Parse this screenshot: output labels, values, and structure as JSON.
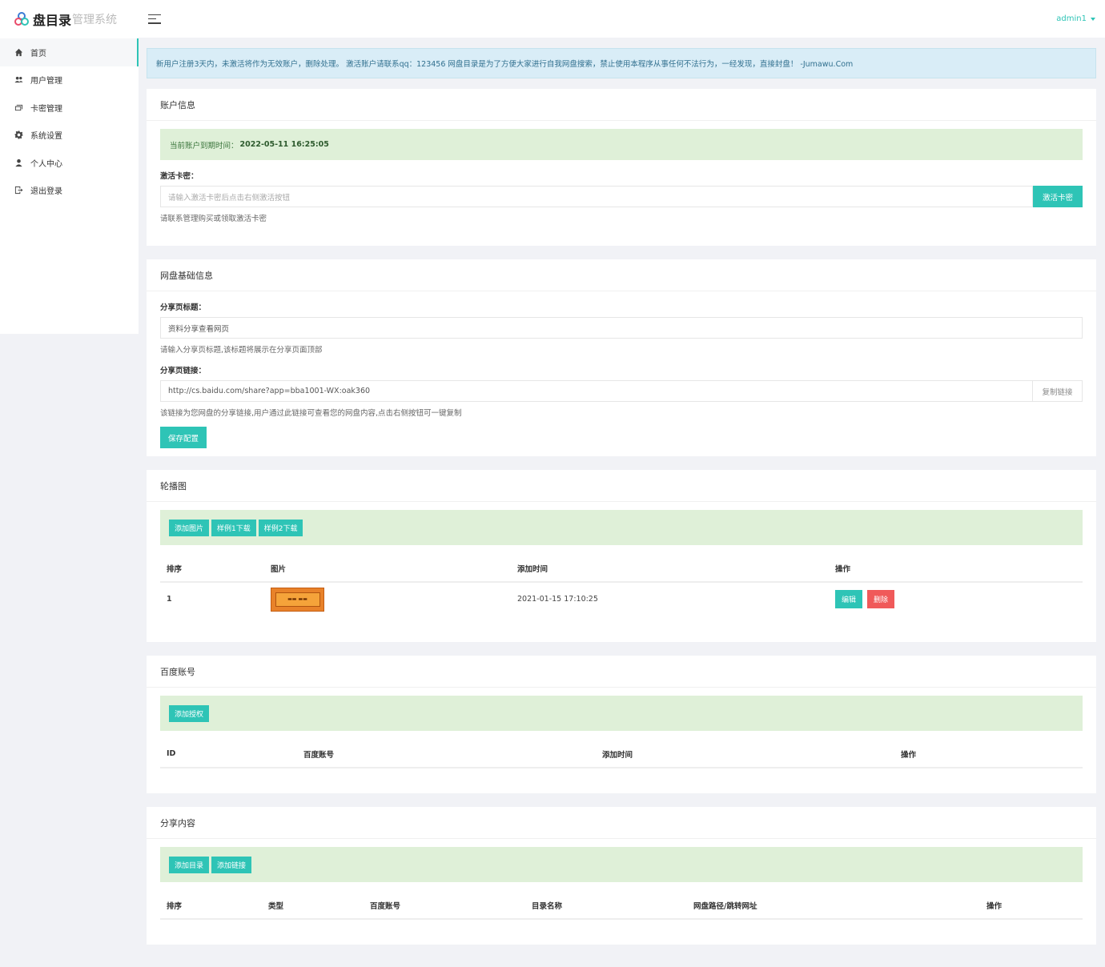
{
  "app": {
    "brand": "盘目录",
    "brand_sub": "管理系统"
  },
  "sidebar": {
    "items": [
      {
        "label": "首页",
        "icon": "home-icon"
      },
      {
        "label": "用户管理",
        "icon": "users-icon"
      },
      {
        "label": "卡密管理",
        "icon": "cards-icon"
      },
      {
        "label": "系统设置",
        "icon": "gear-icon"
      },
      {
        "label": "个人中心",
        "icon": "person-icon"
      },
      {
        "label": "退出登录",
        "icon": "logout-icon"
      }
    ]
  },
  "header": {
    "user": "admin1"
  },
  "notice": "新用户注册3天内，未激活将作为无效账户，删除处理。 激活账户请联系qq：123456 网盘目录是为了方便大家进行自我网盘搜索，禁止使用本程序从事任何不法行为，一经发现，直接封盘！ -Jumawu.Com",
  "account": {
    "title": "账户信息",
    "expiry_label": "当前账户到期时间：",
    "expiry_value": "2022-05-11 16:25:05",
    "card_label": "激活卡密：",
    "card_placeholder": "请输入激活卡密后点击右侧激活按钮",
    "activate_button": "激活卡密",
    "help": "请联系管理购买或领取激活卡密"
  },
  "disk_info": {
    "title": "网盘基础信息",
    "share_title_label": "分享页标题：",
    "share_title_value": "资料分享查看网页",
    "share_title_help": "请输入分享页标题,该标题将展示在分享页面顶部",
    "share_link_label": "分享页链接：",
    "share_link_value": "http://cs.baidu.com/share?app=bba1001-WX:oak360",
    "copy_button": "复制链接",
    "share_link_help": "该链接为您网盘的分享链接,用户通过此链接可查看您的网盘内容,点击右侧按钮可一键复制",
    "save_button": "保存配置"
  },
  "carousel": {
    "title": "轮播图",
    "buttons": [
      "添加图片",
      "样例1下载",
      "样例2下载"
    ],
    "columns": [
      "排序",
      "图片",
      "添加时间",
      "操作"
    ],
    "rows": [
      {
        "order": "1",
        "time": "2021-01-15 17:10:25",
        "edit": "编辑",
        "delete": "删除"
      }
    ]
  },
  "baidu": {
    "title": "百度账号",
    "buttons": [
      "添加授权"
    ],
    "columns": [
      "ID",
      "百度账号",
      "添加时间",
      "操作"
    ]
  },
  "share_content": {
    "title": "分享内容",
    "buttons": [
      "添加目录",
      "添加链接"
    ],
    "columns": [
      "排序",
      "类型",
      "百度账号",
      "目录名称",
      "网盘路径/跳转网址",
      "操作"
    ]
  }
}
